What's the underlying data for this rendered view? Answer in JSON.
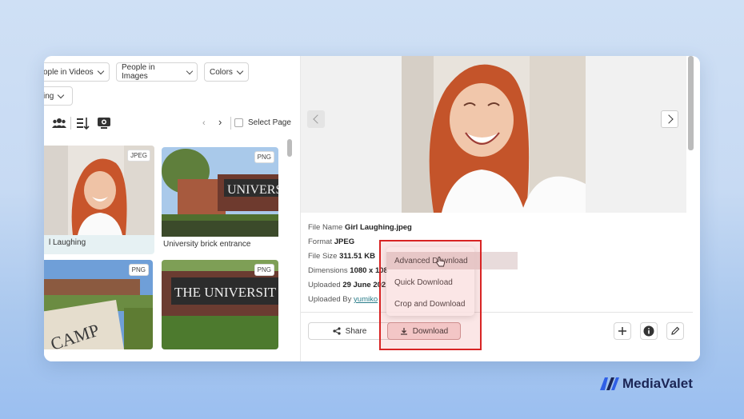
{
  "filters": {
    "people_in_videos": "ople in Videos",
    "people_in_images": "People in Images",
    "colors": "Colors",
    "sorting": "ing"
  },
  "toolbar": {
    "select_page": "Select Page"
  },
  "assets": [
    {
      "name": "l Laughing",
      "format": "JPEG",
      "selected": true
    },
    {
      "name": "University brick entrance",
      "format": "PNG",
      "selected": false
    },
    {
      "name": "",
      "format": "PNG",
      "selected": false,
      "sign_text": "CAMP"
    },
    {
      "name": "",
      "format": "PNG",
      "selected": false,
      "sign_text": "THE UNIVERSIT"
    }
  ],
  "sign_texts": {
    "university": "UNIVERSIT"
  },
  "details": {
    "file_name_label": "File Name",
    "file_name": "Girl Laughing.jpeg",
    "format_label": "Format",
    "format": "JPEG",
    "file_size_label": "File Size",
    "file_size": "311.51 KB",
    "dimensions_label": "Dimensions",
    "dimensions": "1080 x 108",
    "uploaded_label": "Uploaded",
    "uploaded": "29 June 202",
    "uploaded_by_label": "Uploaded By",
    "uploaded_by": "yumiko"
  },
  "actions": {
    "share": "Share",
    "download": "Download"
  },
  "download_menu": {
    "items": [
      "Advanced Download",
      "Quick Download",
      "Crop and Download"
    ]
  },
  "brand": {
    "name": "MediaValet",
    "color": "#1b2555",
    "accent": "#2f5fe6"
  },
  "colors": {
    "highlight": "#d82424"
  }
}
